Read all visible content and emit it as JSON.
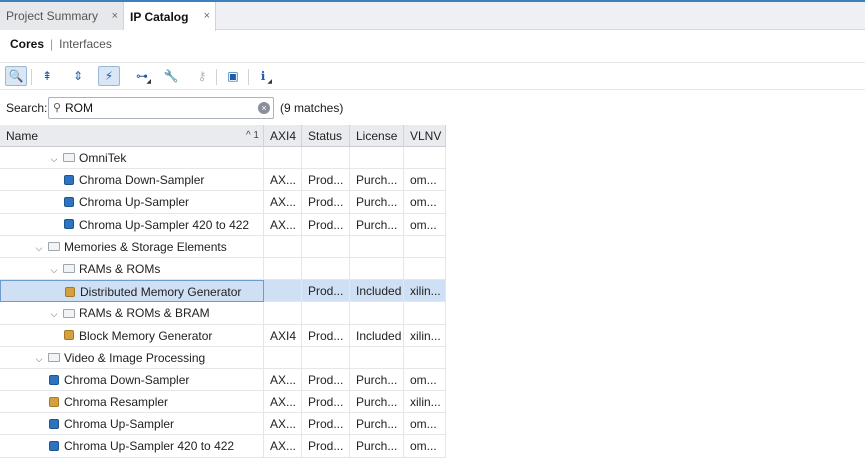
{
  "tabs": [
    {
      "label": "Project Summary",
      "active": false
    },
    {
      "label": "IP Catalog",
      "active": true
    }
  ],
  "close_glyph": "×",
  "subtabs": {
    "cores": "Cores",
    "separator": "|",
    "interfaces": "Interfaces"
  },
  "toolbar": [
    {
      "icon": "search-icon",
      "glyph": "🔍",
      "active": true
    },
    {
      "icon": "collapse-all-icon",
      "glyph": "⇞"
    },
    {
      "icon": "expand-all-icon",
      "glyph": "⇕"
    },
    {
      "icon": "filter-icon",
      "glyph": "⚡",
      "active": true
    },
    {
      "icon": "hierarchy-icon",
      "glyph": "⊶",
      "dropdown": true
    },
    {
      "icon": "wrench-icon",
      "glyph": "🔧"
    },
    {
      "icon": "key-icon",
      "glyph": "⚷",
      "disabled": true
    },
    {
      "icon": "chip-icon",
      "glyph": "▣"
    },
    {
      "icon": "info-icon",
      "glyph": "ℹ",
      "dropdown": true
    }
  ],
  "search": {
    "label": "Search:",
    "value": "ROM",
    "matches": "(9 matches)"
  },
  "columns": {
    "name": "Name",
    "sort": "^ 1",
    "axi4": "AXI4",
    "status": "Status",
    "license": "License",
    "vlnv": "VLNV"
  },
  "rows": [
    {
      "type": "folder",
      "level": 2,
      "name": "OmniTek"
    },
    {
      "type": "ip",
      "level": 3,
      "color": "blue",
      "name": "Chroma Down-Sampler",
      "axi4": "AX...",
      "status": "Prod...",
      "license": "Purch...",
      "vlnv": "om..."
    },
    {
      "type": "ip",
      "level": 3,
      "color": "blue",
      "name": "Chroma Up-Sampler",
      "axi4": "AX...",
      "status": "Prod...",
      "license": "Purch...",
      "vlnv": "om..."
    },
    {
      "type": "ip",
      "level": 3,
      "color": "blue",
      "name": "Chroma Up-Sampler 420 to 422",
      "axi4": "AX...",
      "status": "Prod...",
      "license": "Purch...",
      "vlnv": "om..."
    },
    {
      "type": "folder",
      "level": 1,
      "name": "Memories & Storage Elements"
    },
    {
      "type": "folder",
      "level": 2,
      "name": "RAMs & ROMs"
    },
    {
      "type": "ip",
      "level": 3,
      "color": "gold",
      "name": "Distributed Memory Generator",
      "axi4": "",
      "status": "Prod...",
      "license": "Included",
      "vlnv": "xilin...",
      "selected": true
    },
    {
      "type": "folder",
      "level": 2,
      "name": "RAMs & ROMs & BRAM"
    },
    {
      "type": "ip",
      "level": 3,
      "color": "gold",
      "name": "Block Memory Generator",
      "axi4": "AXI4",
      "status": "Prod...",
      "license": "Included",
      "vlnv": "xilin..."
    },
    {
      "type": "folder",
      "level": 1,
      "name": "Video & Image Processing"
    },
    {
      "type": "ip",
      "level": 2,
      "color": "blue",
      "name": "Chroma Down-Sampler",
      "axi4": "AX...",
      "status": "Prod...",
      "license": "Purch...",
      "vlnv": "om..."
    },
    {
      "type": "ip",
      "level": 2,
      "color": "gold",
      "name": "Chroma Resampler",
      "axi4": "AX...",
      "status": "Prod...",
      "license": "Purch...",
      "vlnv": "xilin..."
    },
    {
      "type": "ip",
      "level": 2,
      "color": "blue",
      "name": "Chroma Up-Sampler",
      "axi4": "AX...",
      "status": "Prod...",
      "license": "Purch...",
      "vlnv": "om..."
    },
    {
      "type": "ip",
      "level": 2,
      "color": "blue",
      "name": "Chroma Up-Sampler 420 to 422",
      "axi4": "AX...",
      "status": "Prod...",
      "license": "Purch...",
      "vlnv": "om..."
    }
  ]
}
